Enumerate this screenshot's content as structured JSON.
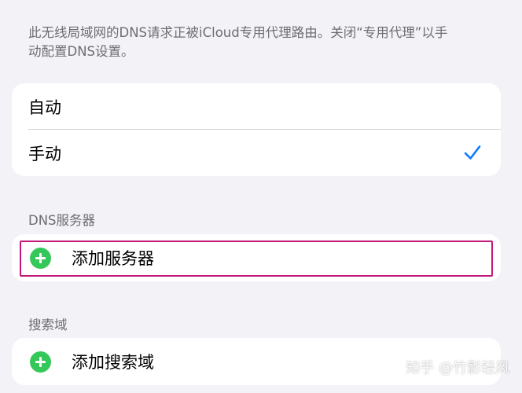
{
  "note": {
    "line1": "此无线局域网的DNS请求正被iCloud专用代理路由。关闭“专用代理”以手",
    "line2": "动配置DNS设置。"
  },
  "dns_mode": {
    "options": [
      {
        "label": "自动",
        "selected": false
      },
      {
        "label": "手动",
        "selected": true
      }
    ]
  },
  "dns_servers": {
    "header": "DNS服务器",
    "add_label": "添加服务器"
  },
  "search_domains": {
    "header": "搜索域",
    "add_label": "添加搜索域"
  },
  "watermark": "知乎 @竹影轻风",
  "colors": {
    "accent": "#0a7aff",
    "add_green": "#34c759",
    "highlight": "#c2187a",
    "background": "#f2f2f7"
  }
}
